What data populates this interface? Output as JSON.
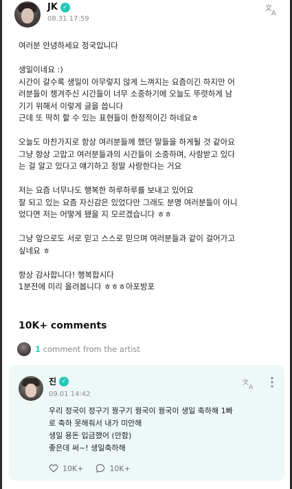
{
  "post": {
    "author": "JK",
    "date": "08.31 17:59",
    "paragraphs": [
      "여러분 안녕하세요 정국입니다",
      "생일이네요 :)\n시간이 갈수록 생일이 아무렇지 않게 느껴지는 요즘이긴 하지만 어\n러분들이 챙겨주신 시간들이 너무 소중하기에 오늘도 뚜렷하게 남\n기기 위해서 이렇게 글을 씁니다\n근데 또 딱히 할 수 있는 표현들이 한정적이긴 하네요ㅎ",
      "오늘도 마찬가지로 항상 여러분들께 했던 말들을 하게될 것 같아요\n그냥 항상 고맙고 여러분들과의 시간들이 소중하며, 사랑받고 있다\n는 걸 알고 있다고 얘기하고 정말 사랑한다는 거요",
      "저는 요즘 너무나도 행복한 하루하루를 보내고 있어요\n잘 되고 있는 요즘 자신감은 있었다만 그래도 분명 여러분들이 아니\n었다면 저는 어떻게 됐을 지 모르겠습니다 ㅎㅎ",
      "그냥 앞으로도 서로 믿고 스스로 믿으며 여러분들과 같이 걸어가고\n싶네요 ㅎ",
      "항상 감사합니다! 행복합시다\n1분전에 미리 올려봅니다 ㅎㅎㅎ아포방포"
    ]
  },
  "comments_count": "10K+ comments",
  "artist_comments": {
    "count": "1",
    "label": "comment from the artist"
  },
  "comment": {
    "author": "진",
    "date": "09.01 14:42",
    "lines": [
      "우리 정국이 정구기 꿩구기 꿩국이 꿩국이 생일 축하해 1빠",
      "로 축하 못해줘서 내가 미안해",
      "생일 용돈 입금했어 (안함)",
      "좋은데 써~! 생일축하해"
    ],
    "likes": "10K+",
    "replies": "10K+"
  },
  "icons": [
    "avatar",
    "verified-icon",
    "translate-icon",
    "more-icon",
    "like-icon",
    "reply-icon"
  ],
  "colors": {
    "accent": "#21c8b6",
    "card_bg": "#eef9f7",
    "muted": "#8a8a8e"
  }
}
